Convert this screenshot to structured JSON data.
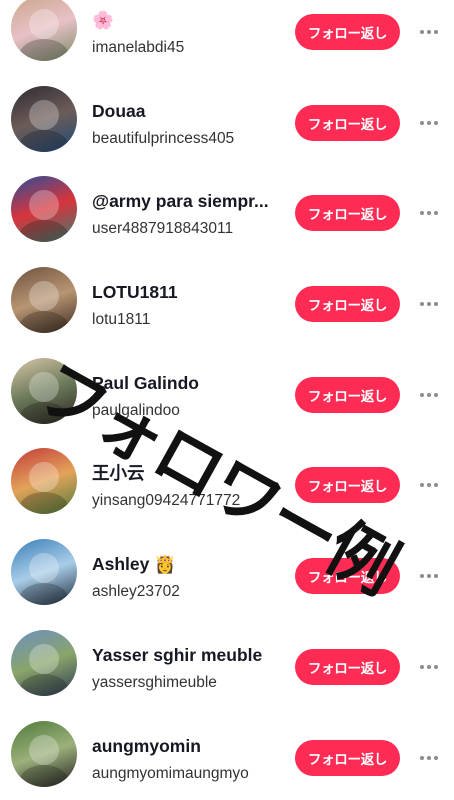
{
  "follow_back_label": "フォロー返し",
  "users": [
    {
      "name": "🌸",
      "handle": "imanelabdi45",
      "avatar_colors": [
        "#c9a58a",
        "#e8c1c6",
        "#7a8b6a"
      ]
    },
    {
      "name": "Douaa",
      "handle": "beautifulprincess405",
      "avatar_colors": [
        "#2e2a33",
        "#6c5c57",
        "#1f4a7a"
      ]
    },
    {
      "name": "@army para siempr...",
      "handle": "user4887918843011",
      "avatar_colors": [
        "#2a4f9b",
        "#d8343c",
        "#3b7c6f"
      ]
    },
    {
      "name": "LOTU1811",
      "handle": "lotu1811",
      "avatar_colors": [
        "#6e5240",
        "#b89572",
        "#3a2a22"
      ]
    },
    {
      "name": "Paul Galindo",
      "handle": "paulgalindoo",
      "avatar_colors": [
        "#d9c7a8",
        "#6b7a5a",
        "#2a2620"
      ]
    },
    {
      "name": "王小云",
      "handle": "yinsang09424771772",
      "avatar_colors": [
        "#c23a3a",
        "#e3a35a",
        "#4d7a3b"
      ]
    },
    {
      "name": "Ashley 👸",
      "handle": "ashley23702",
      "avatar_colors": [
        "#3a7fb8",
        "#a9cde8",
        "#1c2a3a"
      ]
    },
    {
      "name": "Yasser sghir meuble",
      "handle": "yassersghimeuble",
      "avatar_colors": [
        "#6b8fc2",
        "#8aa56a",
        "#2c3a55"
      ]
    },
    {
      "name": "aungmyomin",
      "handle": "aungmyomimaungmyo",
      "avatar_colors": [
        "#4e7a3a",
        "#9cb07a",
        "#222222"
      ]
    }
  ],
  "overlay_text": "フォロワー例"
}
